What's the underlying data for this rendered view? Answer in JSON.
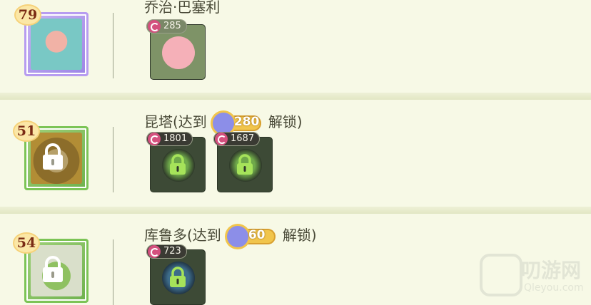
{
  "characters": [
    {
      "level": "79",
      "name_text": "乔治·巴塞利",
      "locked": false,
      "items": [
        {
          "cost": "285",
          "locked": false
        }
      ]
    },
    {
      "level": "51",
      "name_text": "昆塔(达到",
      "unlock_value": "280",
      "unlock_suffix": "解锁)",
      "locked": true,
      "items": [
        {
          "cost": "1801",
          "locked": true
        },
        {
          "cost": "1687",
          "locked": true
        }
      ]
    },
    {
      "level": "54",
      "name_text": "库鲁多(达到",
      "unlock_value": "60",
      "unlock_suffix": "解锁)",
      "locked": true,
      "items": [
        {
          "cost": "723",
          "locked": true
        }
      ]
    }
  ],
  "watermark": {
    "title": "叨游网",
    "subtitle": "Qleyou.com"
  },
  "colors": {
    "lock_green": "#a6e35a",
    "level_text": "#7a2b14",
    "name_text": "#4a4a38"
  },
  "icons": [
    "lock-icon",
    "swirl-currency-icon",
    "star-badge-icon"
  ]
}
